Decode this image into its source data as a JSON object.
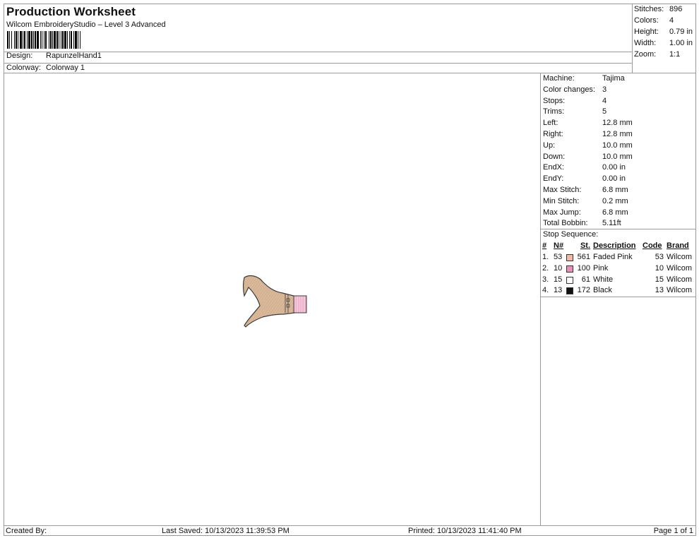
{
  "header": {
    "title": "Production Worksheet",
    "subtitle": "Wilcom EmbroideryStudio – Level 3 Advanced",
    "design_label": "Design:",
    "design_value": "RapunzelHand1",
    "colorway_label": "Colorway:",
    "colorway_value": "Colorway 1"
  },
  "summary": {
    "stitches_label": "Stitches:",
    "stitches_value": "896",
    "colors_label": "Colors:",
    "colors_value": "4",
    "height_label": "Height:",
    "height_value": "0.79 in",
    "width_label": "Width:",
    "width_value": "1.00 in",
    "zoom_label": "Zoom:",
    "zoom_value": "1:1"
  },
  "info": [
    {
      "label": "Machine:",
      "value": "Tajima"
    },
    {
      "label": "Color changes:",
      "value": "3"
    },
    {
      "label": "Stops:",
      "value": "4"
    },
    {
      "label": "Trims:",
      "value": "5"
    },
    {
      "label": "Left:",
      "value": "12.8 mm"
    },
    {
      "label": "Right:",
      "value": "12.8 mm"
    },
    {
      "label": "Up:",
      "value": "10.0 mm"
    },
    {
      "label": "Down:",
      "value": "10.0 mm"
    },
    {
      "label": "EndX:",
      "value": "0.00 in"
    },
    {
      "label": "EndY:",
      "value": "0.00 in"
    },
    {
      "label": "Max Stitch:",
      "value": "6.8 mm"
    },
    {
      "label": "Min Stitch:",
      "value": "0.2 mm"
    },
    {
      "label": "Max Jump:",
      "value": "6.8 mm"
    },
    {
      "label": "Total Bobbin:",
      "value": "5.11ft"
    }
  ],
  "stop_sequence": {
    "title": "Stop Sequence:",
    "headers": {
      "num": "#",
      "n": "N#",
      "st": "St.",
      "description": "Description",
      "code": "Code",
      "brand": "Brand"
    },
    "rows": [
      {
        "num": "1.",
        "n": "53",
        "color": "#f2b9a6",
        "st": "561",
        "description": "Faded Pink",
        "code": "53",
        "brand": "Wilcom"
      },
      {
        "num": "2.",
        "n": "10",
        "color": "#e98fb8",
        "st": "100",
        "description": "Pink",
        "code": "10",
        "brand": "Wilcom"
      },
      {
        "num": "3.",
        "n": "15",
        "color": "#ffffff",
        "st": "61",
        "description": "White",
        "code": "15",
        "brand": "Wilcom"
      },
      {
        "num": "4.",
        "n": "13",
        "color": "#111111",
        "st": "172",
        "description": "Black",
        "code": "13",
        "brand": "Wilcom"
      }
    ]
  },
  "footer": {
    "created_by": "Created By:",
    "last_saved": "Last Saved: 10/13/2023 11:39:53 PM",
    "printed": "Printed: 10/13/2023 11:41:40 PM",
    "page": "Page 1 of 1"
  },
  "design_colors": {
    "skin": "#d9b99a",
    "skin_stitch": "#c8a383",
    "cuff": "#f0a9c6",
    "outline": "#3a3a3a"
  }
}
